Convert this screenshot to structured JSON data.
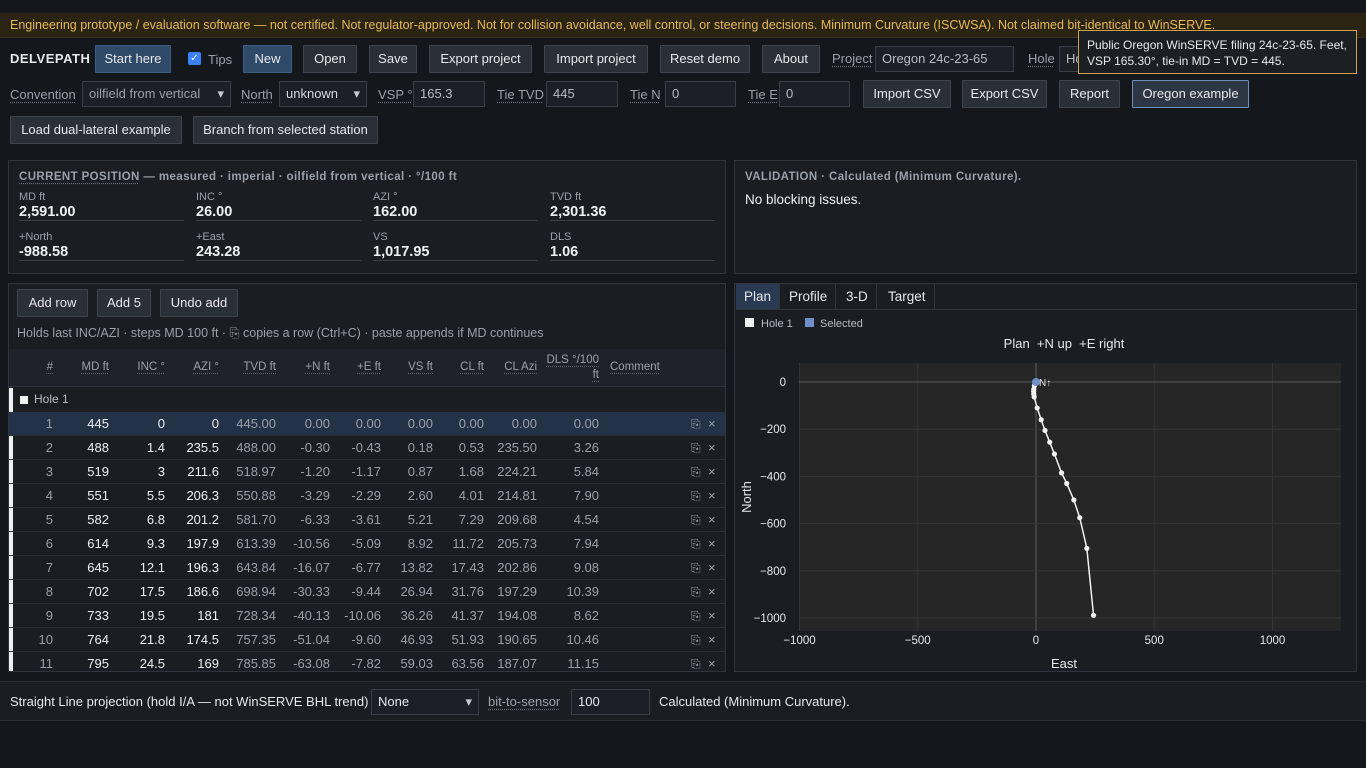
{
  "banner": "Engineering prototype / evaluation software — not certified. Not regulator-approved. Not for collision avoidance, well control, or steering decisions. Minimum Curvature (ISCWSA). Not claimed bit-identical to WinSERVE.",
  "toolbar": {
    "brand": "DELVEPATH",
    "start_here": "Start here",
    "tips": "Tips",
    "new": "New",
    "open": "Open",
    "save": "Save",
    "export_project": "Export project",
    "import_project": "Import project",
    "reset_demo": "Reset demo",
    "about": "About",
    "project_label": "Project",
    "project_value": "Oregon 24c-23-65",
    "hole_label": "Hole",
    "hole_value": "Ho"
  },
  "tooltip": "Public Oregon WinSERVE filing 24c-23-65. Feet, VSP 165.30°, tie-in MD = TVD = 445.",
  "settings": {
    "convention_label": "Convention",
    "convention_value": "oilfield from vertical",
    "north_label": "North",
    "north_value": "unknown",
    "vsp_label": "VSP °",
    "vsp_value": "165.3",
    "tie_tvd_label": "Tie TVD",
    "tie_tvd_value": "445",
    "tie_n_label": "Tie N",
    "tie_n_value": "0",
    "tie_e_label": "Tie E",
    "tie_e_value": "0",
    "import_csv": "Import CSV",
    "export_csv": "Export CSV",
    "report": "Report",
    "oregon_example": "Oregon example",
    "load_dual": "Load dual-lateral example",
    "branch": "Branch from selected station"
  },
  "current": {
    "title": "CURRENT POSITION",
    "subtitle": " — measured · imperial · oilfield from vertical · °/100 ft",
    "stats": [
      {
        "k": "MD ft",
        "v": "2,591.00"
      },
      {
        "k": "INC °",
        "v": "26.00"
      },
      {
        "k": "AZI °",
        "v": "162.00"
      },
      {
        "k": "TVD ft",
        "v": "2,301.36"
      },
      {
        "k": "+North",
        "v": "-988.58"
      },
      {
        "k": "+East",
        "v": "243.28"
      },
      {
        "k": "VS",
        "v": "1,017.95"
      },
      {
        "k": "DLS",
        "v": "1.06"
      }
    ]
  },
  "validation": {
    "title": "VALIDATION · Calculated (Minimum Curvature).",
    "message": "No blocking issues."
  },
  "table": {
    "add_row": "Add row",
    "add5": "Add 5",
    "undo": "Undo add",
    "hint": "Holds last INC/AZI · steps MD 100 ft · ⎘ copies a row (Ctrl+C) · paste appends if MD continues",
    "headers": [
      "#",
      "MD ft",
      "INC °",
      "AZI °",
      "TVD ft",
      "+N ft",
      "+E ft",
      "VS ft",
      "CL ft",
      "CL Azi",
      "DLS °/100",
      "ft",
      "Comment"
    ],
    "group": "Hole 1",
    "rows": [
      [
        "1",
        "445",
        "0",
        "0",
        "445.00",
        "0.00",
        "0.00",
        "0.00",
        "0.00",
        "0.00",
        "0.00"
      ],
      [
        "2",
        "488",
        "1.4",
        "235.5",
        "488.00",
        "-0.30",
        "-0.43",
        "0.18",
        "0.53",
        "235.50",
        "3.26"
      ],
      [
        "3",
        "519",
        "3",
        "211.6",
        "518.97",
        "-1.20",
        "-1.17",
        "0.87",
        "1.68",
        "224.21",
        "5.84"
      ],
      [
        "4",
        "551",
        "5.5",
        "206.3",
        "550.88",
        "-3.29",
        "-2.29",
        "2.60",
        "4.01",
        "214.81",
        "7.90"
      ],
      [
        "5",
        "582",
        "6.8",
        "201.2",
        "581.70",
        "-6.33",
        "-3.61",
        "5.21",
        "7.29",
        "209.68",
        "4.54"
      ],
      [
        "6",
        "614",
        "9.3",
        "197.9",
        "613.39",
        "-10.56",
        "-5.09",
        "8.92",
        "11.72",
        "205.73",
        "7.94"
      ],
      [
        "7",
        "645",
        "12.1",
        "196.3",
        "643.84",
        "-16.07",
        "-6.77",
        "13.82",
        "17.43",
        "202.86",
        "9.08"
      ],
      [
        "8",
        "702",
        "17.5",
        "186.6",
        "698.94",
        "-30.33",
        "-9.44",
        "26.94",
        "31.76",
        "197.29",
        "10.39"
      ],
      [
        "9",
        "733",
        "19.5",
        "181",
        "728.34",
        "-40.13",
        "-10.06",
        "36.26",
        "41.37",
        "194.08",
        "8.62"
      ],
      [
        "10",
        "764",
        "21.8",
        "174.5",
        "757.35",
        "-51.04",
        "-9.60",
        "46.93",
        "51.93",
        "190.65",
        "10.46"
      ],
      [
        "11",
        "795",
        "24.5",
        "169",
        "785.85",
        "-63.08",
        "-7.82",
        "59.03",
        "63.56",
        "187.07",
        "11.15"
      ]
    ]
  },
  "plot": {
    "tabs": [
      "Plan",
      "Profile",
      "3-D",
      "Target"
    ],
    "legend_hole": "Hole 1",
    "legend_selected": "Selected",
    "title": "Plan  +N up  +E right",
    "north_marker": "N↑",
    "xlabel": "East",
    "ylabel": "North",
    "colors": {
      "track": "#f2f2f2",
      "selected": "#6f8fc8",
      "bg": "#262626"
    }
  },
  "chart_data": {
    "type": "line",
    "title": "Plan  +N up  +E right",
    "xlabel": "East",
    "ylabel": "North",
    "xlim": [
      -1000,
      1000
    ],
    "ylim": [
      -1000,
      0
    ],
    "xticks": [
      -1000,
      -500,
      0,
      500,
      1000
    ],
    "yticks": [
      0,
      -200,
      -400,
      -600,
      -800,
      -1000
    ],
    "grid": true,
    "legend": "top-left",
    "series": [
      {
        "name": "Hole 1",
        "x": [
          0,
          -0.43,
          -1.17,
          -2.29,
          -3.61,
          -5.09,
          -6.77,
          -9.44,
          -10.06,
          -9.6,
          -7.82,
          5,
          22,
          38,
          58,
          78,
          108,
          130,
          160,
          185,
          215,
          243.28
        ],
        "y": [
          0,
          -0.3,
          -1.2,
          -3.29,
          -6.33,
          -10.56,
          -16.07,
          -30.33,
          -40.13,
          -51.04,
          -63.08,
          -110,
          -160,
          -205,
          -255,
          -305,
          -385,
          -430,
          -500,
          -575,
          -705,
          -988.58
        ]
      },
      {
        "name": "Selected",
        "x": [
          0
        ],
        "y": [
          0
        ]
      }
    ]
  },
  "bottom": {
    "label": "Straight Line projection (hold I/A — not WinSERVE BHL trend)",
    "select_value": "None",
    "bts_label": "bit-to-sensor",
    "bts_value": "100",
    "status": "Calculated (Minimum Curvature)."
  }
}
